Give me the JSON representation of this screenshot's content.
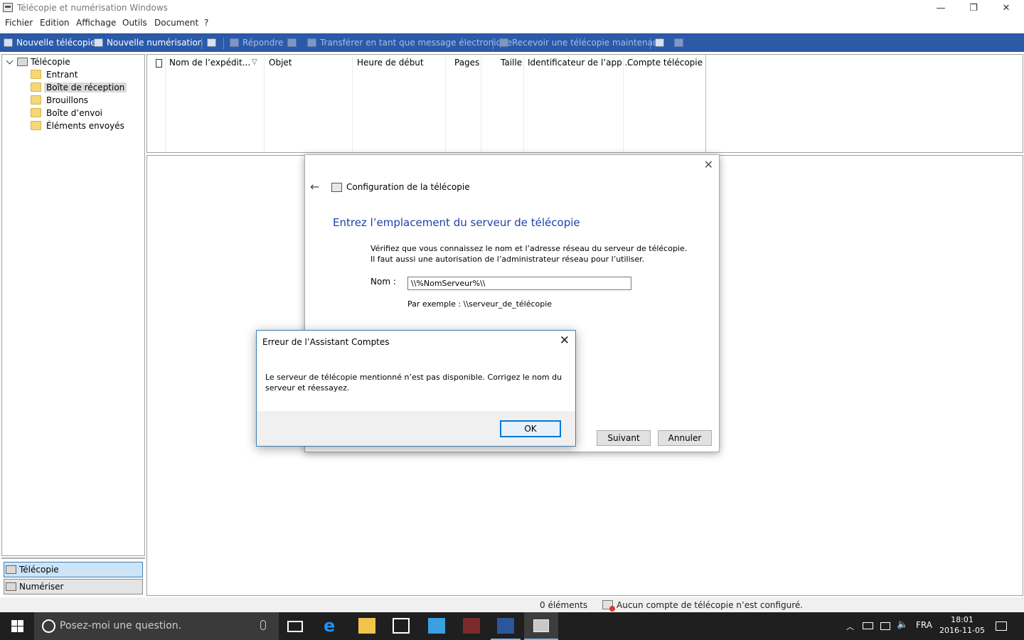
{
  "window": {
    "title": "Télécopie et numérisation Windows",
    "minimize_glyph": "—",
    "restore_glyph": "❐",
    "close_glyph": "✕"
  },
  "menu": [
    "Fichier",
    "Edition",
    "Affichage",
    "Outils",
    "Document",
    "?"
  ],
  "toolbar": {
    "new_fax": "Nouvelle télécopie",
    "new_scan": "Nouvelle numérisation",
    "reply": "Répondre",
    "forward_email": "Transférer en tant que message électronique",
    "receive_now": "Recevoir une télécopie maintenant"
  },
  "tree": {
    "root": "Télécopie",
    "items": [
      "Entrant",
      "Boîte de réception",
      "Brouillons",
      "Boîte d’envoi",
      "Éléments envoyés"
    ],
    "selected": "Boîte de réception"
  },
  "nav": {
    "fax": "Télécopie",
    "scan": "Numériser"
  },
  "list": {
    "columns": [
      "Nom de l’expédit...",
      "Objet",
      "Heure de début",
      "Pages",
      "Taille",
      "Identificateur de l’app...",
      "Compte télécopie"
    ]
  },
  "status": {
    "count": "0 éléments",
    "message": "Aucun compte de télécopie n’est configuré."
  },
  "config_dialog": {
    "header": "Configuration de la télécopie",
    "heading": "Entrez l’emplacement du serveur de télécopie",
    "desc_line1": "Vérifiez que vous connaissez le nom et l’adresse réseau du serveur de télécopie.",
    "desc_line2": "Il faut aussi  une autorisation de l’administrateur réseau pour l’utiliser.",
    "name_label": "Nom :",
    "name_value": "\\\\%NomServeur%\\\\",
    "example": "Par exemple : \\\\serveur_de_télécopie",
    "next": "Suivant",
    "cancel": "Annuler"
  },
  "error_dialog": {
    "title": "Erreur de l’Assistant Comptes",
    "message": "Le serveur de télécopie mentionné n’est pas disponible. Corrigez le nom du serveur et réessayez.",
    "ok": "OK"
  },
  "taskbar": {
    "search_placeholder": "Posez-moi une question.",
    "language": "FRA",
    "time": "18:01",
    "date": "2016-11-05"
  },
  "colors": {
    "toolbar_bg": "#2b5aa8",
    "heading_blue": "#1f3fa8",
    "taskbar_bg": "#1f1f1f",
    "accent": "#0078d7"
  }
}
